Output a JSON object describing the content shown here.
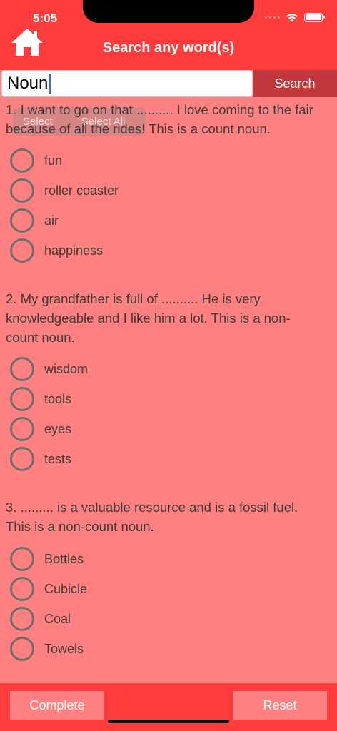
{
  "status_bar": {
    "time": "5:05"
  },
  "header": {
    "title": "Search any word(s)",
    "home_icon": "home-icon"
  },
  "search": {
    "value": "Noun",
    "button_label": "Search"
  },
  "selection_popup": {
    "select_label": "Select",
    "select_all_label": "Select All"
  },
  "questions": [
    {
      "text": "1. I want to go on that .......... I love coming to the fair because of all the rides! This is a count noun.",
      "options": [
        "fun",
        "roller coaster",
        "air",
        "happiness"
      ]
    },
    {
      "text": "2. My grandfather is full of .......... He is very knowledgeable and I like him a lot. This is a non-count noun.",
      "options": [
        "wisdom",
        "tools",
        "eyes",
        "tests"
      ]
    },
    {
      "text": "3. ......... is a valuable resource and is a fossil fuel. This is a non-count noun.",
      "options": [
        "Bottles",
        "Cubicle",
        "Coal",
        "Towels"
      ]
    }
  ],
  "footer": {
    "complete_label": "Complete",
    "reset_label": "Reset"
  },
  "colors": {
    "primary": "#ff3b3b",
    "background": "#ff8080",
    "search_button": "#c0383b"
  }
}
